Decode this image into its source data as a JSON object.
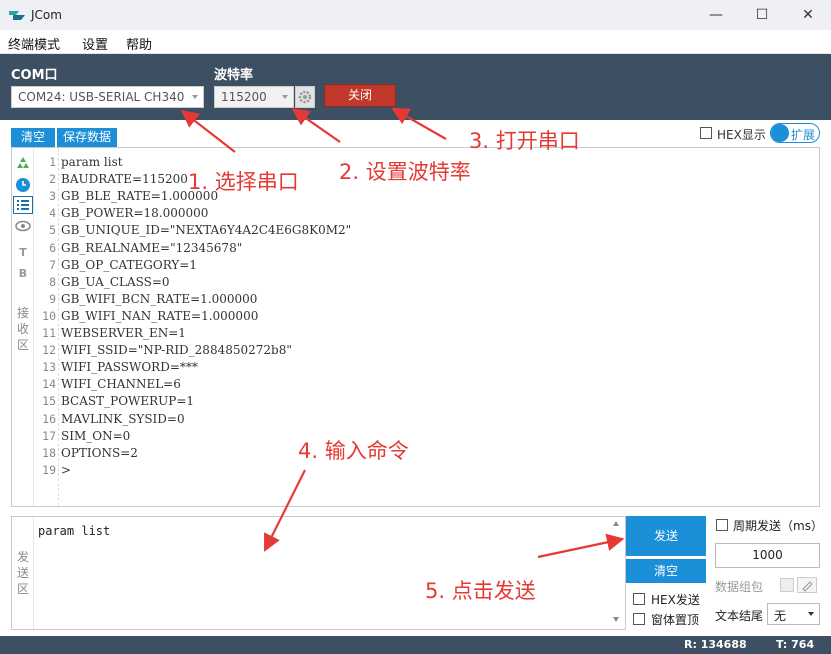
{
  "window": {
    "title": "JCom",
    "minimize": "—",
    "maximize": "☐",
    "close": "✕"
  },
  "menu": {
    "items": [
      "终端模式",
      "设置",
      "帮助"
    ]
  },
  "serial": {
    "com_label": "COM口",
    "com_value": "COM24: USB-SERIAL CH340",
    "baud_label": "波特率",
    "baud_value": "115200",
    "close_label": "关闭"
  },
  "receive": {
    "clear_label": "清空",
    "save_label": "保存数据",
    "hex_display_label": "HEX显示",
    "expand_label": "扩展",
    "side_icons": [
      "recycle-icon",
      "clock-icon",
      "list-icon",
      "eye-icon",
      "T",
      "B"
    ],
    "side_label": [
      "接",
      "收",
      "区"
    ],
    "line_numbers": [
      "1",
      "2",
      "3",
      "4",
      "5",
      "6",
      "7",
      "8",
      "9",
      "10",
      "11",
      "12",
      "13",
      "14",
      "15",
      "16",
      "17",
      "18",
      "19"
    ],
    "lines": [
      "param list",
      "BAUDRATE=115200",
      "GB_BLE_RATE=1.000000",
      "GB_POWER=18.000000",
      "GB_UNIQUE_ID=\"NEXTA6Y4A2C4E6G8K0M2\"",
      "GB_REALNAME=\"12345678\"",
      "GB_OP_CATEGORY=1",
      "GB_UA_CLASS=0",
      "GB_WIFI_BCN_RATE=1.000000",
      "GB_WIFI_NAN_RATE=1.000000",
      "WEBSERVER_EN=1",
      "WIFI_SSID=\"NP-RID_2884850272b8\"",
      "WIFI_PASSWORD=***",
      "WIFI_CHANNEL=6",
      "BCAST_POWERUP=1",
      "MAVLINK_SYSID=0",
      "SIM_ON=0",
      "OPTIONS=2",
      ">"
    ]
  },
  "send": {
    "side_label": [
      "发",
      "送",
      "区"
    ],
    "text": "param list",
    "send_label": "发送",
    "clear_label": "清空",
    "hex_send_label": "HEX发送",
    "pin_top_label": "窗体置顶",
    "period_label": "周期发送（ms）",
    "period_value": "1000",
    "group_label": "数据组包",
    "wrap_label": "文本结尾",
    "wrap_value": "无"
  },
  "status": {
    "r": "R:  134688",
    "t": "T:  764"
  },
  "annotations": {
    "a1": "1. 选择串口",
    "a2": "2. 设置波特率",
    "a3": "3. 打开串口",
    "a4": "4. 输入命令",
    "a5": "5. 点击发送"
  },
  "colors": {
    "header": "#3d4f62",
    "accent": "#1b8fd8",
    "close_button": "#c0392b",
    "annotation": "#e53935"
  }
}
